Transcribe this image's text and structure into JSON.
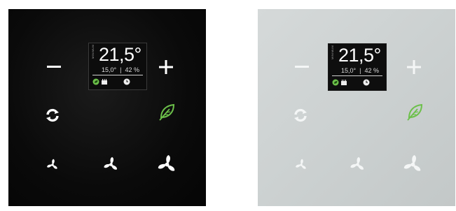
{
  "panels": [
    {
      "id": "dark",
      "display": {
        "mode_label": "MINIMUM",
        "temperature": "21,5°",
        "sub_line": "15,0°  |  42 %",
        "status_icons": [
          "leaf-dot-icon",
          "heater-icon",
          "clock-icon"
        ]
      },
      "buttons": [
        "minus-icon",
        "plus-icon",
        "sync-icon",
        "leaf-icon",
        "fan-low-icon",
        "fan-medium-icon",
        "fan-high-icon"
      ]
    },
    {
      "id": "light",
      "display": {
        "mode_label": "MINIMUM",
        "temperature": "21,5°",
        "sub_line": "15,0°  |  42 %",
        "status_icons": [
          "leaf-dot-icon",
          "heater-icon",
          "clock-icon"
        ]
      },
      "buttons": [
        "minus-icon",
        "plus-icon",
        "sync-icon",
        "leaf-icon",
        "fan-low-icon",
        "fan-medium-icon",
        "fan-high-icon"
      ]
    }
  ],
  "colors": {
    "dark_panel": "#0a0a0a",
    "light_panel": "#cdd2d2",
    "icon_white": "#ffffff",
    "eco_green": "#6cc04a"
  }
}
